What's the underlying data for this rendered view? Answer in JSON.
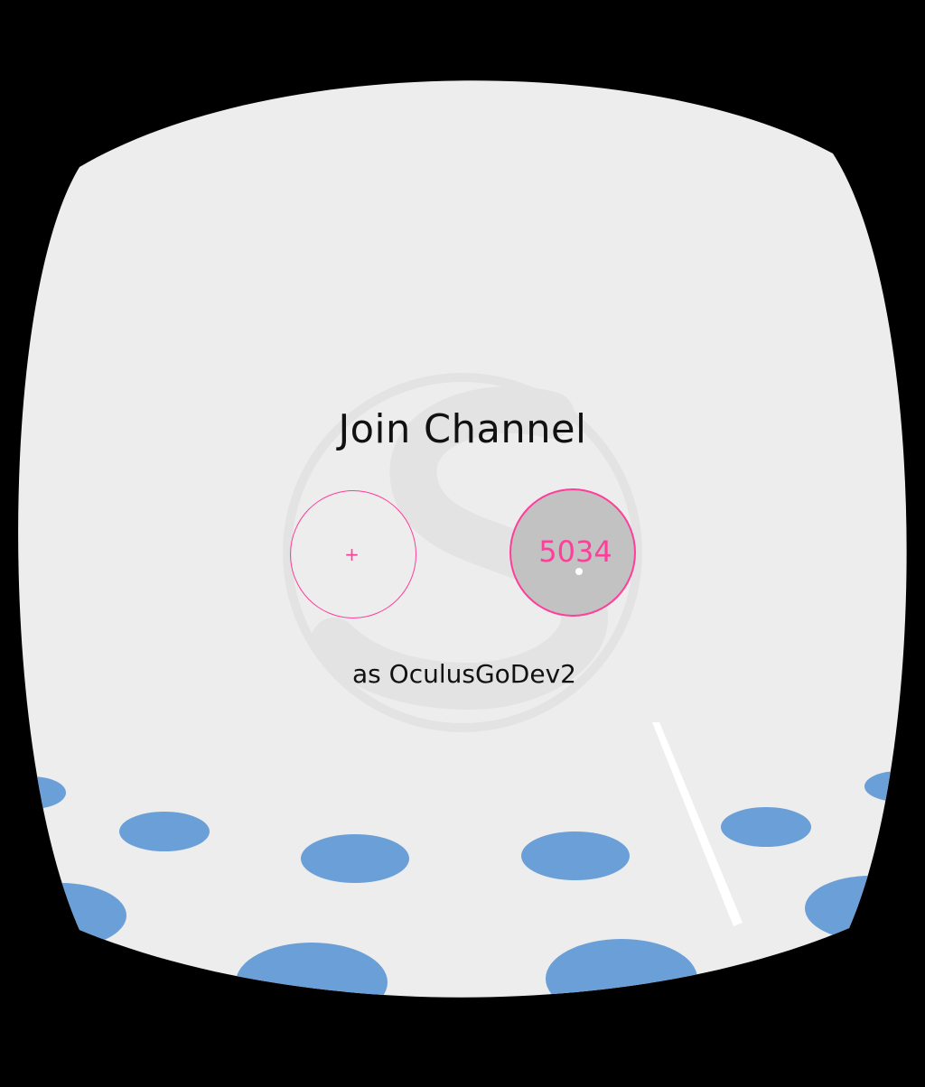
{
  "screen": {
    "title": "Join Channel",
    "subtitle": "as OculusGoDev2"
  },
  "buttons": {
    "add_label": "+",
    "channel_label": "5034"
  },
  "colors": {
    "background": "#ededed",
    "accent": "#ff3d9a",
    "dots": "#6a9fd8",
    "selected_fill": "#c2c2c2",
    "frame": "#000000"
  },
  "icons": {
    "watermark": "logo-watermark",
    "pointer": "controller-laser-pointer",
    "reticle": "gaze-cursor"
  }
}
